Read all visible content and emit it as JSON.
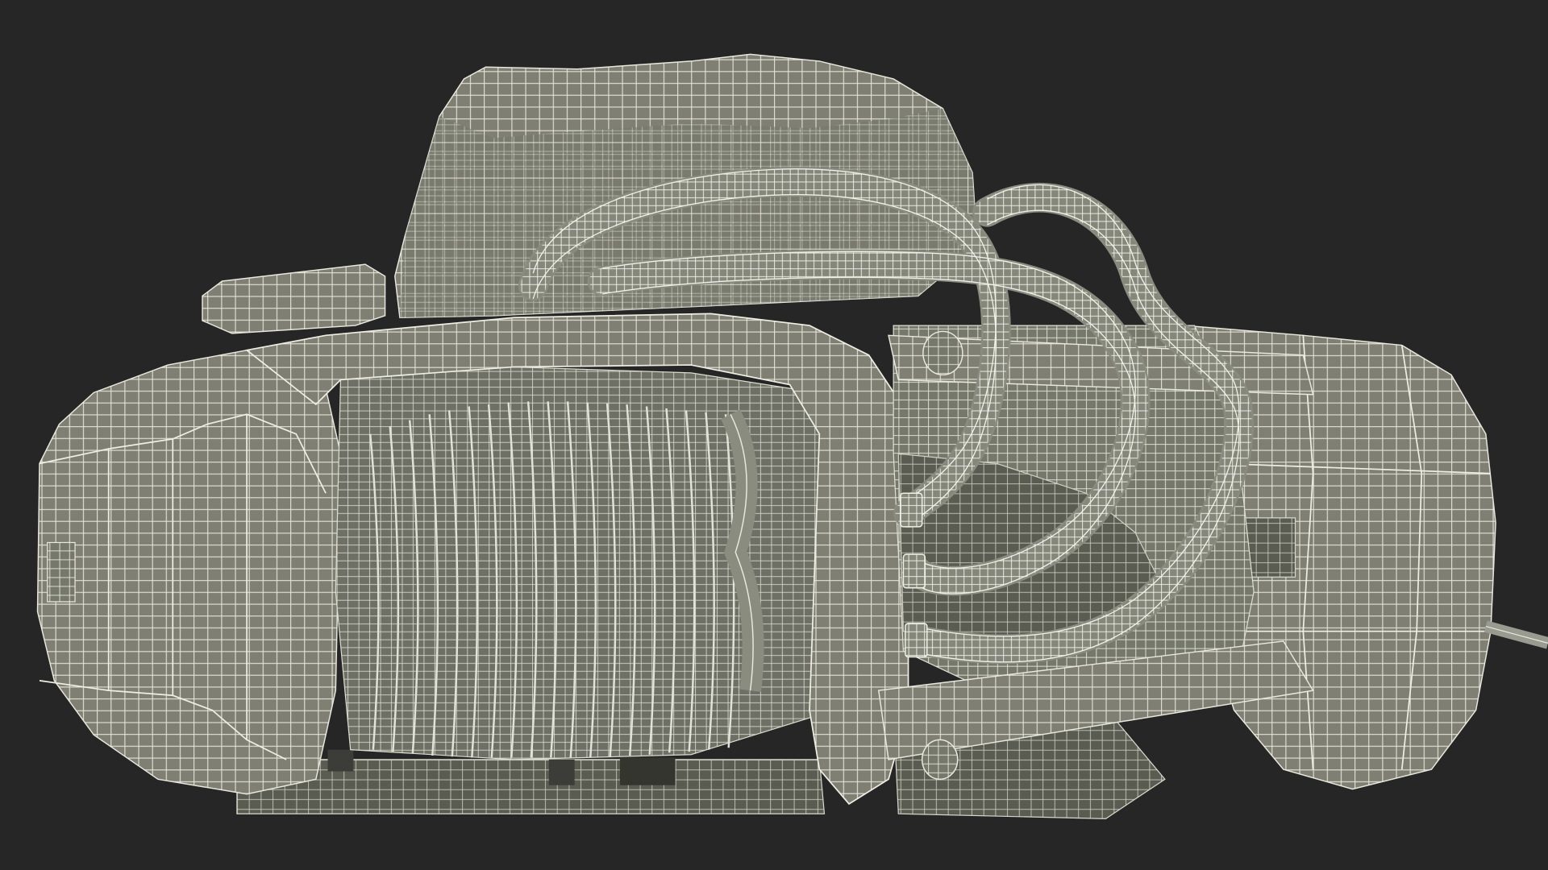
{
  "scene": {
    "subject": "",
    "background_color": "#262626",
    "surface_color": "#7e7e72",
    "surface_dark": "#55574d",
    "wire_color": "#e6e6dc",
    "render_style": "wireframe-on-shaded"
  },
  "parts": [
    {
      "name": "motor-housing-top"
    },
    {
      "name": "left-end-housing"
    },
    {
      "name": "cable-drum"
    },
    {
      "name": "frame-plate"
    },
    {
      "name": "right-end-housing"
    },
    {
      "name": "power-cables"
    },
    {
      "name": "handle-lever"
    },
    {
      "name": "base-feet"
    }
  ]
}
